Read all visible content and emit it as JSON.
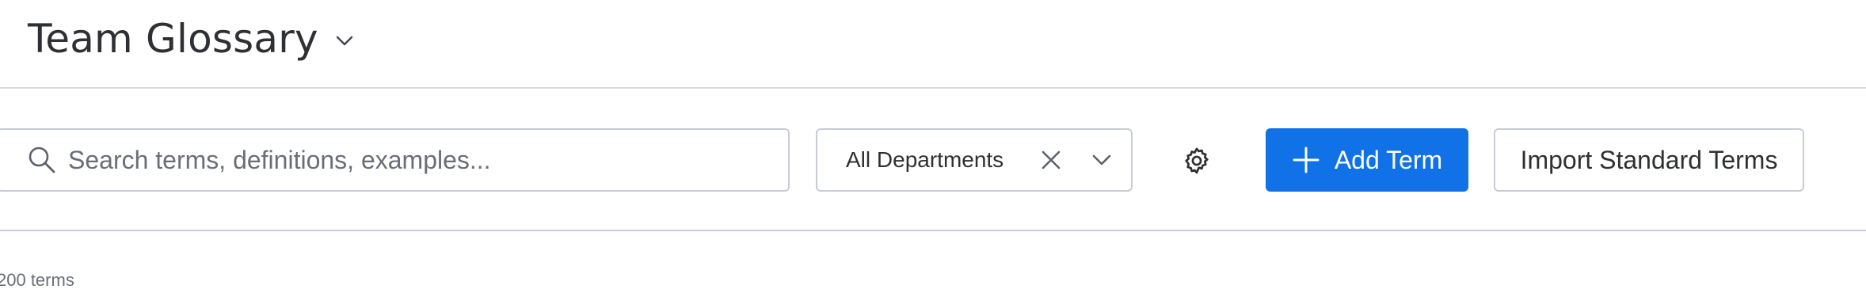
{
  "header": {
    "title": "Team Glossary",
    "title_icon": "chevron-down-icon"
  },
  "toolbar": {
    "search": {
      "placeholder": "Search terms, definitions, examples...",
      "value": "",
      "icon": "search-icon"
    },
    "department_filter": {
      "selected": "All Departments",
      "clear_icon": "close-icon",
      "dropdown_icon": "chevron-down-icon"
    },
    "settings_icon": "gear-icon",
    "add_term_label": "Add Term",
    "add_term_icon": "plus-icon",
    "import_label": "Import Standard Terms"
  },
  "summary": {
    "count_text": "200 terms"
  },
  "colors": {
    "primary": "#1171e6",
    "border": "#c9cbd6",
    "text": "#2f3033",
    "muted_text": "#6b6e78"
  }
}
